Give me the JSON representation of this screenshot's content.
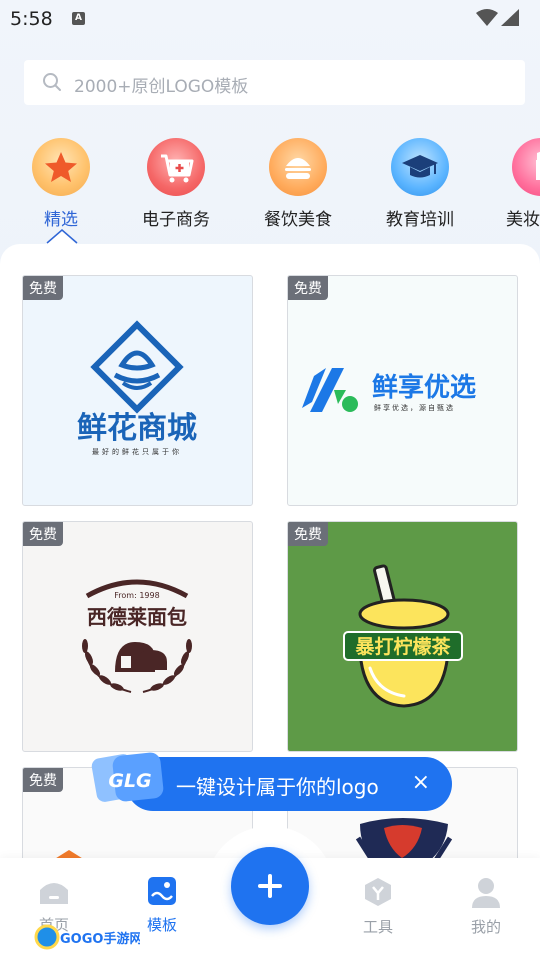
{
  "status_bar": {
    "time": "5:58",
    "indicator": "A"
  },
  "search": {
    "placeholder": "2000+原创LOGO模板"
  },
  "categories": [
    {
      "label": "精选",
      "icon": "star-icon",
      "active": true
    },
    {
      "label": "电子商务",
      "icon": "shopping-cart-icon",
      "active": false
    },
    {
      "label": "餐饮美食",
      "icon": "burger-icon",
      "active": false
    },
    {
      "label": "教育培训",
      "icon": "graduation-cap-icon",
      "active": false
    },
    {
      "label": "美妆",
      "icon": "lipstick-icon",
      "active": false
    }
  ],
  "templates": [
    {
      "badge": "免费",
      "title": "鲜花商城",
      "subtitle": "最好的鲜花只属于你"
    },
    {
      "badge": "免费",
      "title": "鲜享优选",
      "subtitle": "鲜享优选，源自甄选"
    },
    {
      "badge": "免费",
      "title": "西德莱面包",
      "subtitle": "From: 1998"
    },
    {
      "badge": "免费",
      "title": "暴打柠檬茶"
    },
    {
      "badge": "免费"
    },
    {
      "badge": ""
    }
  ],
  "promo": {
    "badge": "GLG",
    "text": "一键设计属于你的logo",
    "close": "×"
  },
  "bottom_nav": [
    {
      "label": "首页",
      "icon": "home-icon",
      "active": false
    },
    {
      "label": "模板",
      "icon": "template-icon",
      "active": true
    },
    {
      "label": "工具",
      "icon": "tools-icon",
      "active": false
    },
    {
      "label": "我的",
      "icon": "profile-icon",
      "active": false
    }
  ],
  "watermark": "GOGO手游网",
  "colors": {
    "accent": "#1f73f0",
    "active_tab": "#2f66d6",
    "badge_bg": "#6b6f78"
  }
}
